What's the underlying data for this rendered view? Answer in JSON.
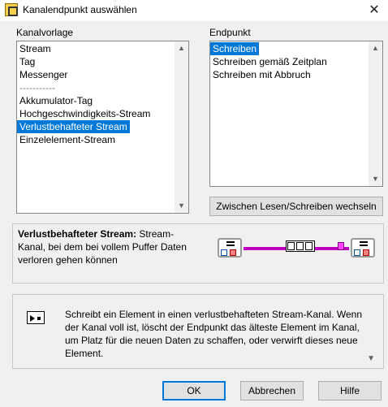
{
  "window": {
    "title": "Kanalendpunkt auswählen",
    "close_glyph": "✕"
  },
  "channel_template": {
    "label": "Kanalvorlage",
    "items": [
      "Stream",
      "Tag",
      "Messenger",
      "-----------",
      "Akkumulator-Tag",
      "Hochgeschwindigkeits-Stream",
      "Verlustbehafteter Stream",
      "Einzelelement-Stream"
    ],
    "selected": "Verlustbehafteter Stream"
  },
  "endpoint": {
    "label": "Endpunkt",
    "items": [
      "Schreiben",
      "Schreiben gemäß Zeitplan",
      "Schreiben mit Abbruch"
    ],
    "selected": "Schreiben"
  },
  "toggle_button": "Zwischen Lesen/Schreiben wechseln",
  "description": {
    "bold": "Verlustbehafteter Stream:",
    "text": " Stream-Kanal, bei dem bei vollem Puffer Daten verloren gehen können"
  },
  "help": {
    "text": "Schreibt ein Element in einen verlustbehafteten Stream-Kanal. Wenn der Kanal voll ist, löscht der Endpunkt das älteste Element im Kanal, um Platz für die neuen Daten zu schaffen, oder verwirft dieses neue Element."
  },
  "buttons": {
    "ok": "OK",
    "cancel": "Abbrechen",
    "help": "Hilfe"
  },
  "icons": {
    "scroll_up": "▲",
    "scroll_down": "▼",
    "help_scroll_down": "▼"
  },
  "colors": {
    "selection": "#0078d7",
    "wire": "#c000c0"
  }
}
